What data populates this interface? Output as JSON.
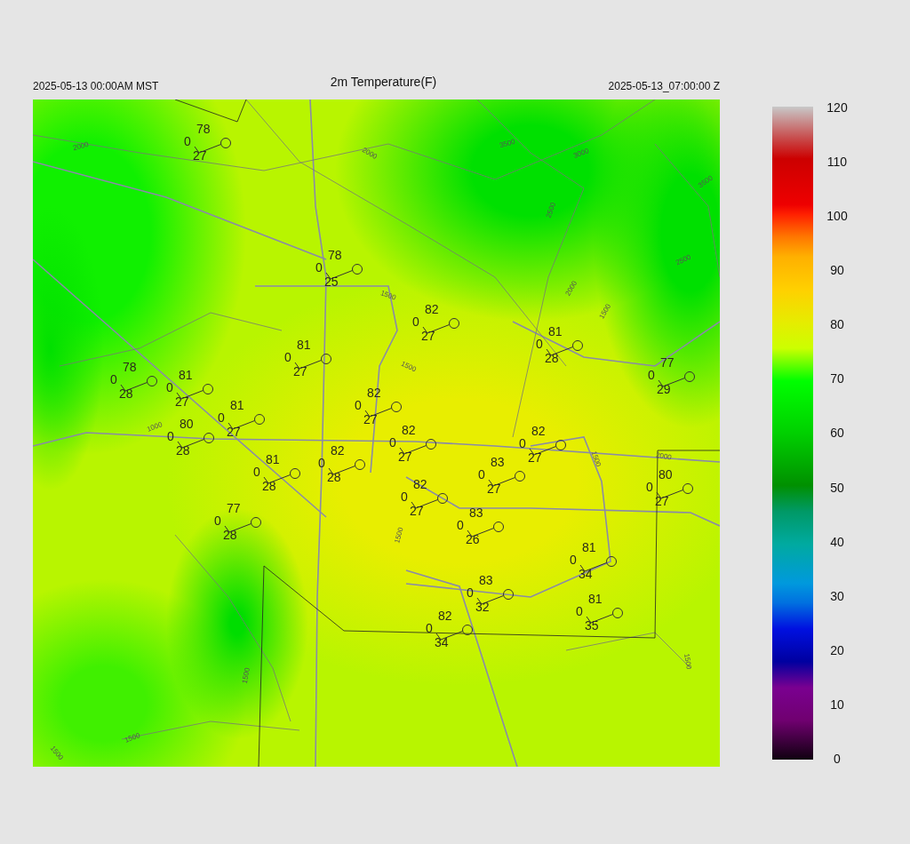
{
  "header": {
    "local_time": "2025-05-13 00:00AM MST",
    "title": "2m Temperature(F)",
    "utc_time": "2025-05-13_07:00:00 Z"
  },
  "map": {
    "stations": [
      {
        "temperature": "78",
        "value": "0",
        "dewpoint": "27"
      },
      {
        "temperature": "78",
        "value": "0",
        "dewpoint": "25"
      },
      {
        "temperature": "82",
        "value": "0",
        "dewpoint": "27"
      },
      {
        "temperature": "81",
        "value": "0",
        "dewpoint": "28"
      },
      {
        "temperature": "81",
        "value": "0",
        "dewpoint": "27"
      },
      {
        "temperature": "78",
        "value": "0",
        "dewpoint": "28"
      },
      {
        "temperature": "81",
        "value": "0",
        "dewpoint": "27"
      },
      {
        "temperature": "77",
        "value": "0",
        "dewpoint": "29"
      },
      {
        "temperature": "82",
        "value": "0",
        "dewpoint": "27"
      },
      {
        "temperature": "81",
        "value": "0",
        "dewpoint": "27"
      },
      {
        "temperature": "80",
        "value": "0",
        "dewpoint": "28"
      },
      {
        "temperature": "82",
        "value": "0",
        "dewpoint": "27"
      },
      {
        "temperature": "82",
        "value": "0",
        "dewpoint": "27"
      },
      {
        "temperature": "82",
        "value": "0",
        "dewpoint": "28"
      },
      {
        "temperature": "81",
        "value": "0",
        "dewpoint": "28"
      },
      {
        "temperature": "83",
        "value": "0",
        "dewpoint": "27"
      },
      {
        "temperature": "82",
        "value": "0",
        "dewpoint": "27"
      },
      {
        "temperature": "80",
        "value": "0",
        "dewpoint": "27"
      },
      {
        "temperature": "77",
        "value": "0",
        "dewpoint": "28"
      },
      {
        "temperature": "83",
        "value": "0",
        "dewpoint": "26"
      },
      {
        "temperature": "81",
        "value": "0",
        "dewpoint": "34"
      },
      {
        "temperature": "83",
        "value": "0",
        "dewpoint": "32"
      },
      {
        "temperature": "81",
        "value": "0",
        "dewpoint": "35"
      },
      {
        "temperature": "82",
        "value": "0",
        "dewpoint": "34"
      }
    ],
    "contour_labels": [
      "2000",
      "2000",
      "3500",
      "3000",
      "2500",
      "3500",
      "2500",
      "2000",
      "1500",
      "1500",
      "1500",
      "1000",
      "1500",
      "2000",
      "1500",
      "1500",
      "1500",
      "1500",
      "1500"
    ]
  },
  "colorbar": {
    "ticks": [
      "120",
      "110",
      "100",
      "90",
      "80",
      "70",
      "60",
      "50",
      "40",
      "30",
      "20",
      "10",
      "0"
    ]
  }
}
